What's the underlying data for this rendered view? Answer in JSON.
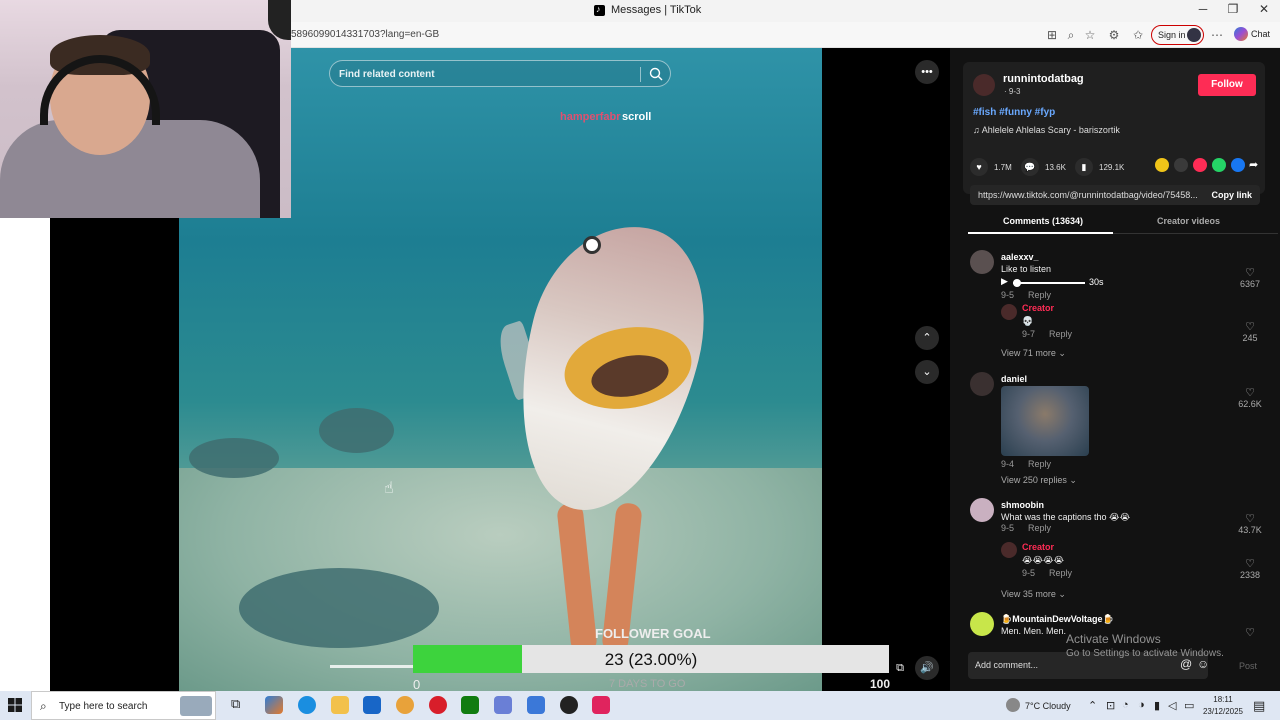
{
  "browser": {
    "window_title": "Messages | TikTok",
    "url": "5896099014331703?lang=en-GB",
    "sign_in_label": "Sign in",
    "chat_label": "Chat"
  },
  "video": {
    "search_placeholder": "Find related content",
    "overlay_left": "hamperfabr",
    "overlay_right": "scroll"
  },
  "follower_goal": {
    "title": "FOLLOWER GOAL",
    "value_text": "23 (23.00%)",
    "progress": 0.23,
    "min": "0",
    "days_left": "7 DAYS TO GO",
    "max": "100"
  },
  "panel": {
    "username": "runnintodatbag",
    "date": "· 9-3",
    "follow_label": "Follow",
    "hashtags": "#fish #funny #fyp",
    "music": "Ahlelele Ahlelas Scary - bariszortik",
    "likes": "1.7M",
    "comments_count": "13.6K",
    "saves": "129.1K",
    "link": "https://www.tiktok.com/@runnintodatbag/video/75458...",
    "copy_link": "Copy link",
    "tab_comments": "Comments (13634)",
    "tab_creator": "Creator videos",
    "reply_label": "Reply",
    "creator_label": "Creator",
    "add_comment": "Add comment...",
    "post_label": "Post"
  },
  "comments": [
    {
      "user": "aalexxv_",
      "text": "Like to listen",
      "audio_len": "30s",
      "date": "9-5",
      "likes": "6367",
      "reply": {
        "text": "💀",
        "date": "9-7",
        "likes": "245"
      },
      "view_more": "View 71 more"
    },
    {
      "user": "daniel",
      "date": "9-4",
      "likes": "62.6K",
      "view_more": "View 250 replies"
    },
    {
      "user": "shmoobin",
      "text": "What was the captions tho 😭😭",
      "date": "9-5",
      "likes": "43.7K",
      "reply": {
        "text": "😭😭😭😭",
        "date": "9-5",
        "likes": "2338"
      },
      "view_more": "View 35 more"
    },
    {
      "user": "🍺MountainDewVoltage🍺",
      "text": "Men. Men. Men."
    }
  ],
  "watermark": {
    "line1": "Activate Windows",
    "line2": "Go to Settings to activate Windows."
  },
  "taskbar": {
    "search_placeholder": "Type here to search",
    "weather": "7°C  Cloudy",
    "time": "18:11",
    "date": "23/12/2025"
  }
}
